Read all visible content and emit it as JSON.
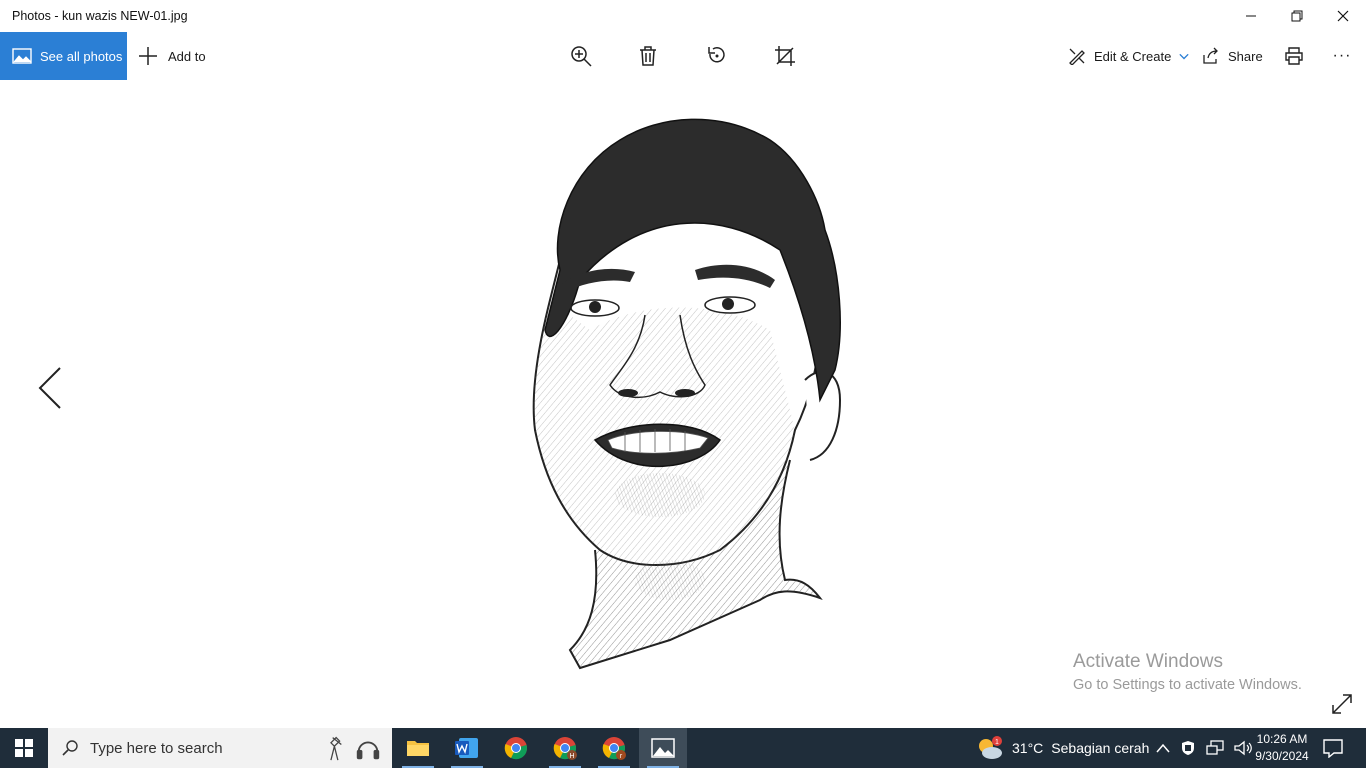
{
  "window": {
    "title": "Photos - kun wazis NEW-01.jpg"
  },
  "toolbar": {
    "see_all_label": "See all photos",
    "add_to_label": "Add to",
    "edit_create_label": "Edit & Create",
    "share_label": "Share",
    "more_label": "···"
  },
  "watermark": {
    "line1": "Activate Windows",
    "line2": "Go to Settings to activate Windows."
  },
  "taskbar": {
    "search_placeholder": "Type here to search",
    "weather_temp": "31°C",
    "weather_text": "Sebagian cerah",
    "weather_badge": "1",
    "time": "10:26 AM",
    "date": "9/30/2024",
    "apps": [
      "file-explorer-icon",
      "word-icon",
      "chrome-icon",
      "chrome-profile-h-icon",
      "chrome-profile-r-icon",
      "photos-icon"
    ]
  },
  "colors": {
    "accent": "#2b7fd5",
    "taskbar": "#1f2d3a",
    "watermark": "#9a9a9a"
  }
}
